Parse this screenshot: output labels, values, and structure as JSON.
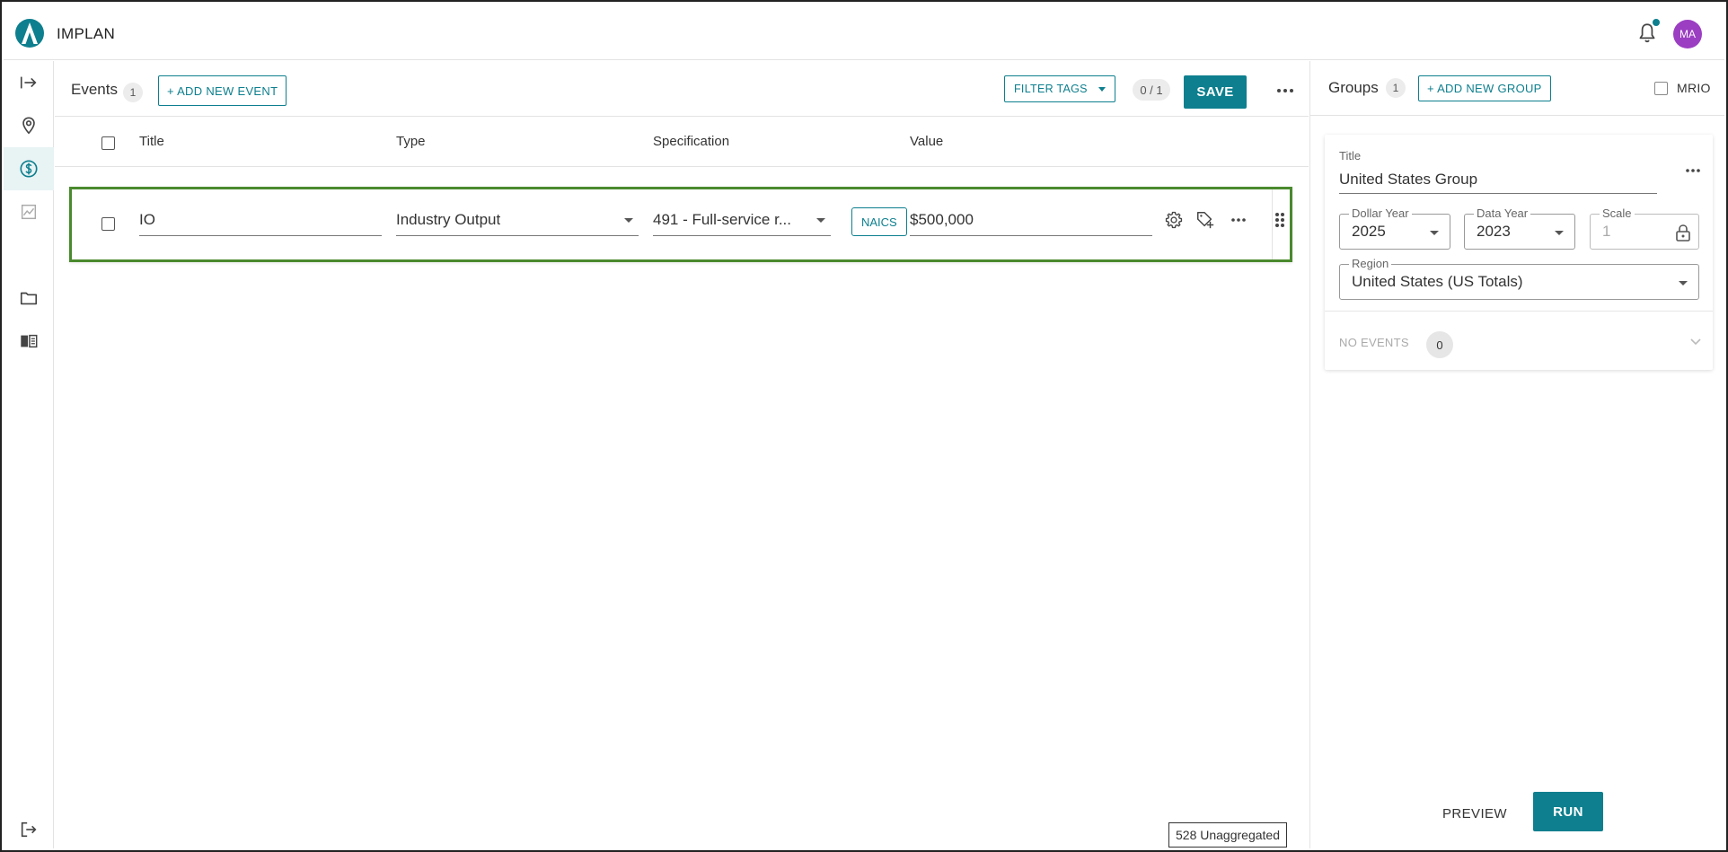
{
  "app": {
    "name": "IMPLAN",
    "avatar_initials": "MA",
    "accent": "#0d7f8e",
    "avatar_color": "#9b3ec2"
  },
  "nav": {
    "items": [
      {
        "name": "expand-icon"
      },
      {
        "name": "location-pin-icon"
      },
      {
        "name": "dollar-icon",
        "active": true
      },
      {
        "name": "chart-icon"
      },
      {
        "name": "folder-icon"
      },
      {
        "name": "book-icon"
      },
      {
        "name": "logout-icon"
      }
    ]
  },
  "events": {
    "title": "Events",
    "count": "1",
    "add_label": "+ ADD NEW EVENT",
    "filter_label": "FILTER TAGS",
    "selected_ratio": "0 / 1",
    "save_label": "SAVE",
    "columns": [
      "Title",
      "Type",
      "Specification",
      "Value"
    ],
    "rows": [
      {
        "title": "IO",
        "type": "Industry Output",
        "specification": "491 - Full-service r...",
        "spec_badge": "NAICS",
        "value": "$500,000"
      }
    ],
    "unaggregated_label": "528 Unaggregated"
  },
  "groups": {
    "title": "Groups",
    "count": "1",
    "add_label": "+ ADD NEW GROUP",
    "mrio_label": "MRIO",
    "card": {
      "title_label": "Title",
      "title_value": "United States Group",
      "dollar_year_label": "Dollar Year",
      "dollar_year_value": "2025",
      "data_year_label": "Data Year",
      "data_year_value": "2023",
      "scale_label": "Scale",
      "scale_value": "1",
      "region_label": "Region",
      "region_value": "United States (US Totals)",
      "no_events_label": "NO EVENTS",
      "no_events_count": "0"
    },
    "preview_label": "PREVIEW",
    "run_label": "RUN"
  }
}
